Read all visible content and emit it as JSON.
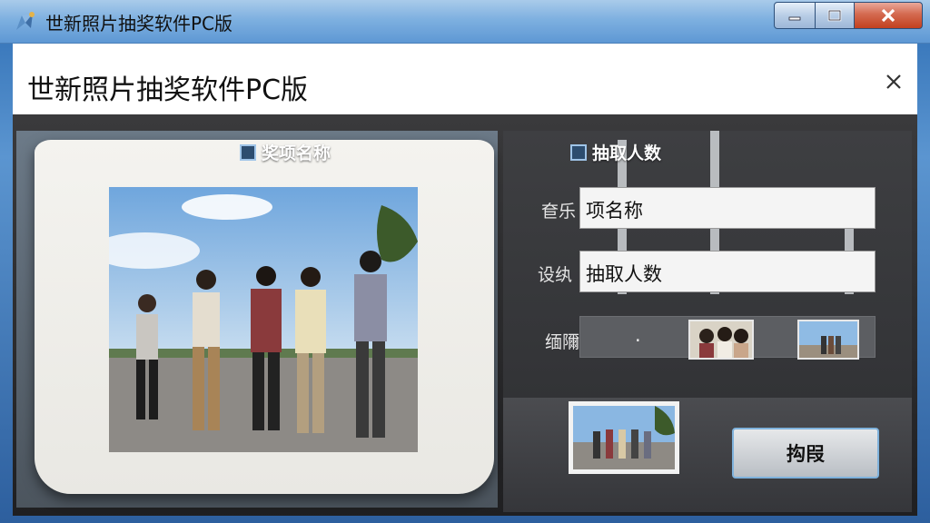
{
  "window": {
    "title": "世新照片抽奖软件PC版"
  },
  "dialog": {
    "title": "世新照片抽奖软件PC版",
    "close_icon": "close-icon"
  },
  "left": {
    "prize_label": "奖项名称"
  },
  "right": {
    "count_label": "抽取人数",
    "row1_label": "奆乐",
    "row1_value": "项名称",
    "row2_label": "设纨",
    "row2_value": "抽取人数",
    "row3_label": "缅隬分情",
    "row3_dot": "."
  },
  "buttons": {
    "draw_label": "抅叚"
  },
  "colors": {
    "accent": "#7fb2dc",
    "titlebar": "#7eb0e0",
    "close_red": "#c2401f"
  }
}
